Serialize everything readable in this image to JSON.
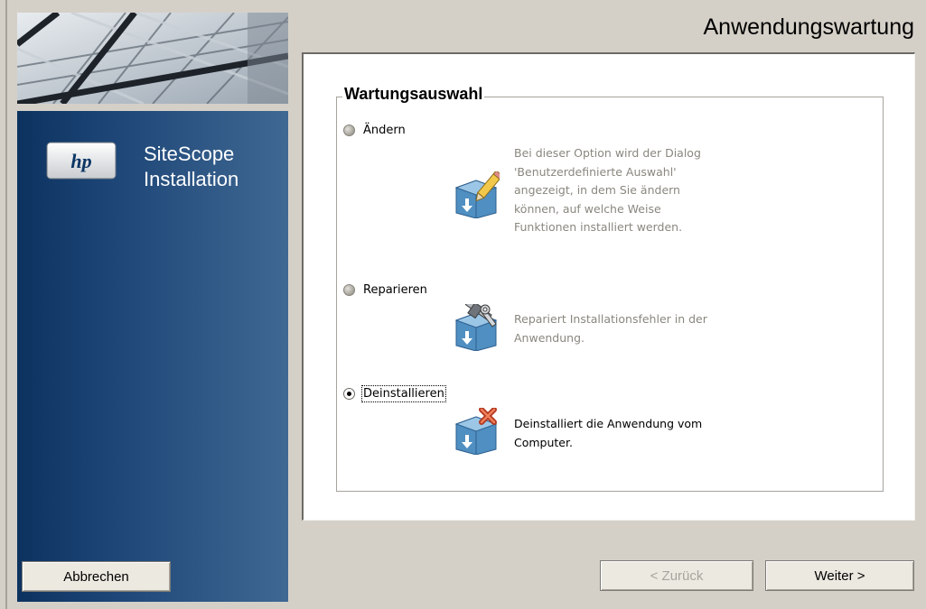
{
  "window": {
    "title": "Anwendungswartung"
  },
  "sidebar": {
    "logo_icon": "hp-logo-icon",
    "product_line1": "SiteScope",
    "product_line2": "Installation",
    "cancel_label": "Abbrechen",
    "colors": {
      "panel_dark": "#0c325f",
      "panel_light": "#3f6893"
    }
  },
  "main": {
    "group_title": "Wartungsauswahl",
    "options": [
      {
        "label": "Ändern",
        "selected": false,
        "enabled": false,
        "icon": "modify-pencil-icon",
        "description": [
          "Bei dieser Option wird der Dialog",
          "'Benutzerdefinierte Auswahl'",
          "angezeigt, in dem Sie ändern",
          "können, auf welche Weise",
          "Funktionen installiert werden."
        ]
      },
      {
        "label": "Reparieren",
        "selected": false,
        "enabled": false,
        "icon": "repair-tools-icon",
        "description": [
          "Repariert Installationsfehler in der",
          "Anwendung."
        ]
      },
      {
        "label": "Deinstallieren",
        "selected": true,
        "enabled": true,
        "icon": "uninstall-x-icon",
        "description": [
          "Deinstalliert die Anwendung vom",
          "Computer."
        ]
      }
    ]
  },
  "buttons": {
    "back_label": "< Zurück",
    "next_label": "Weiter >",
    "back_enabled": false
  }
}
